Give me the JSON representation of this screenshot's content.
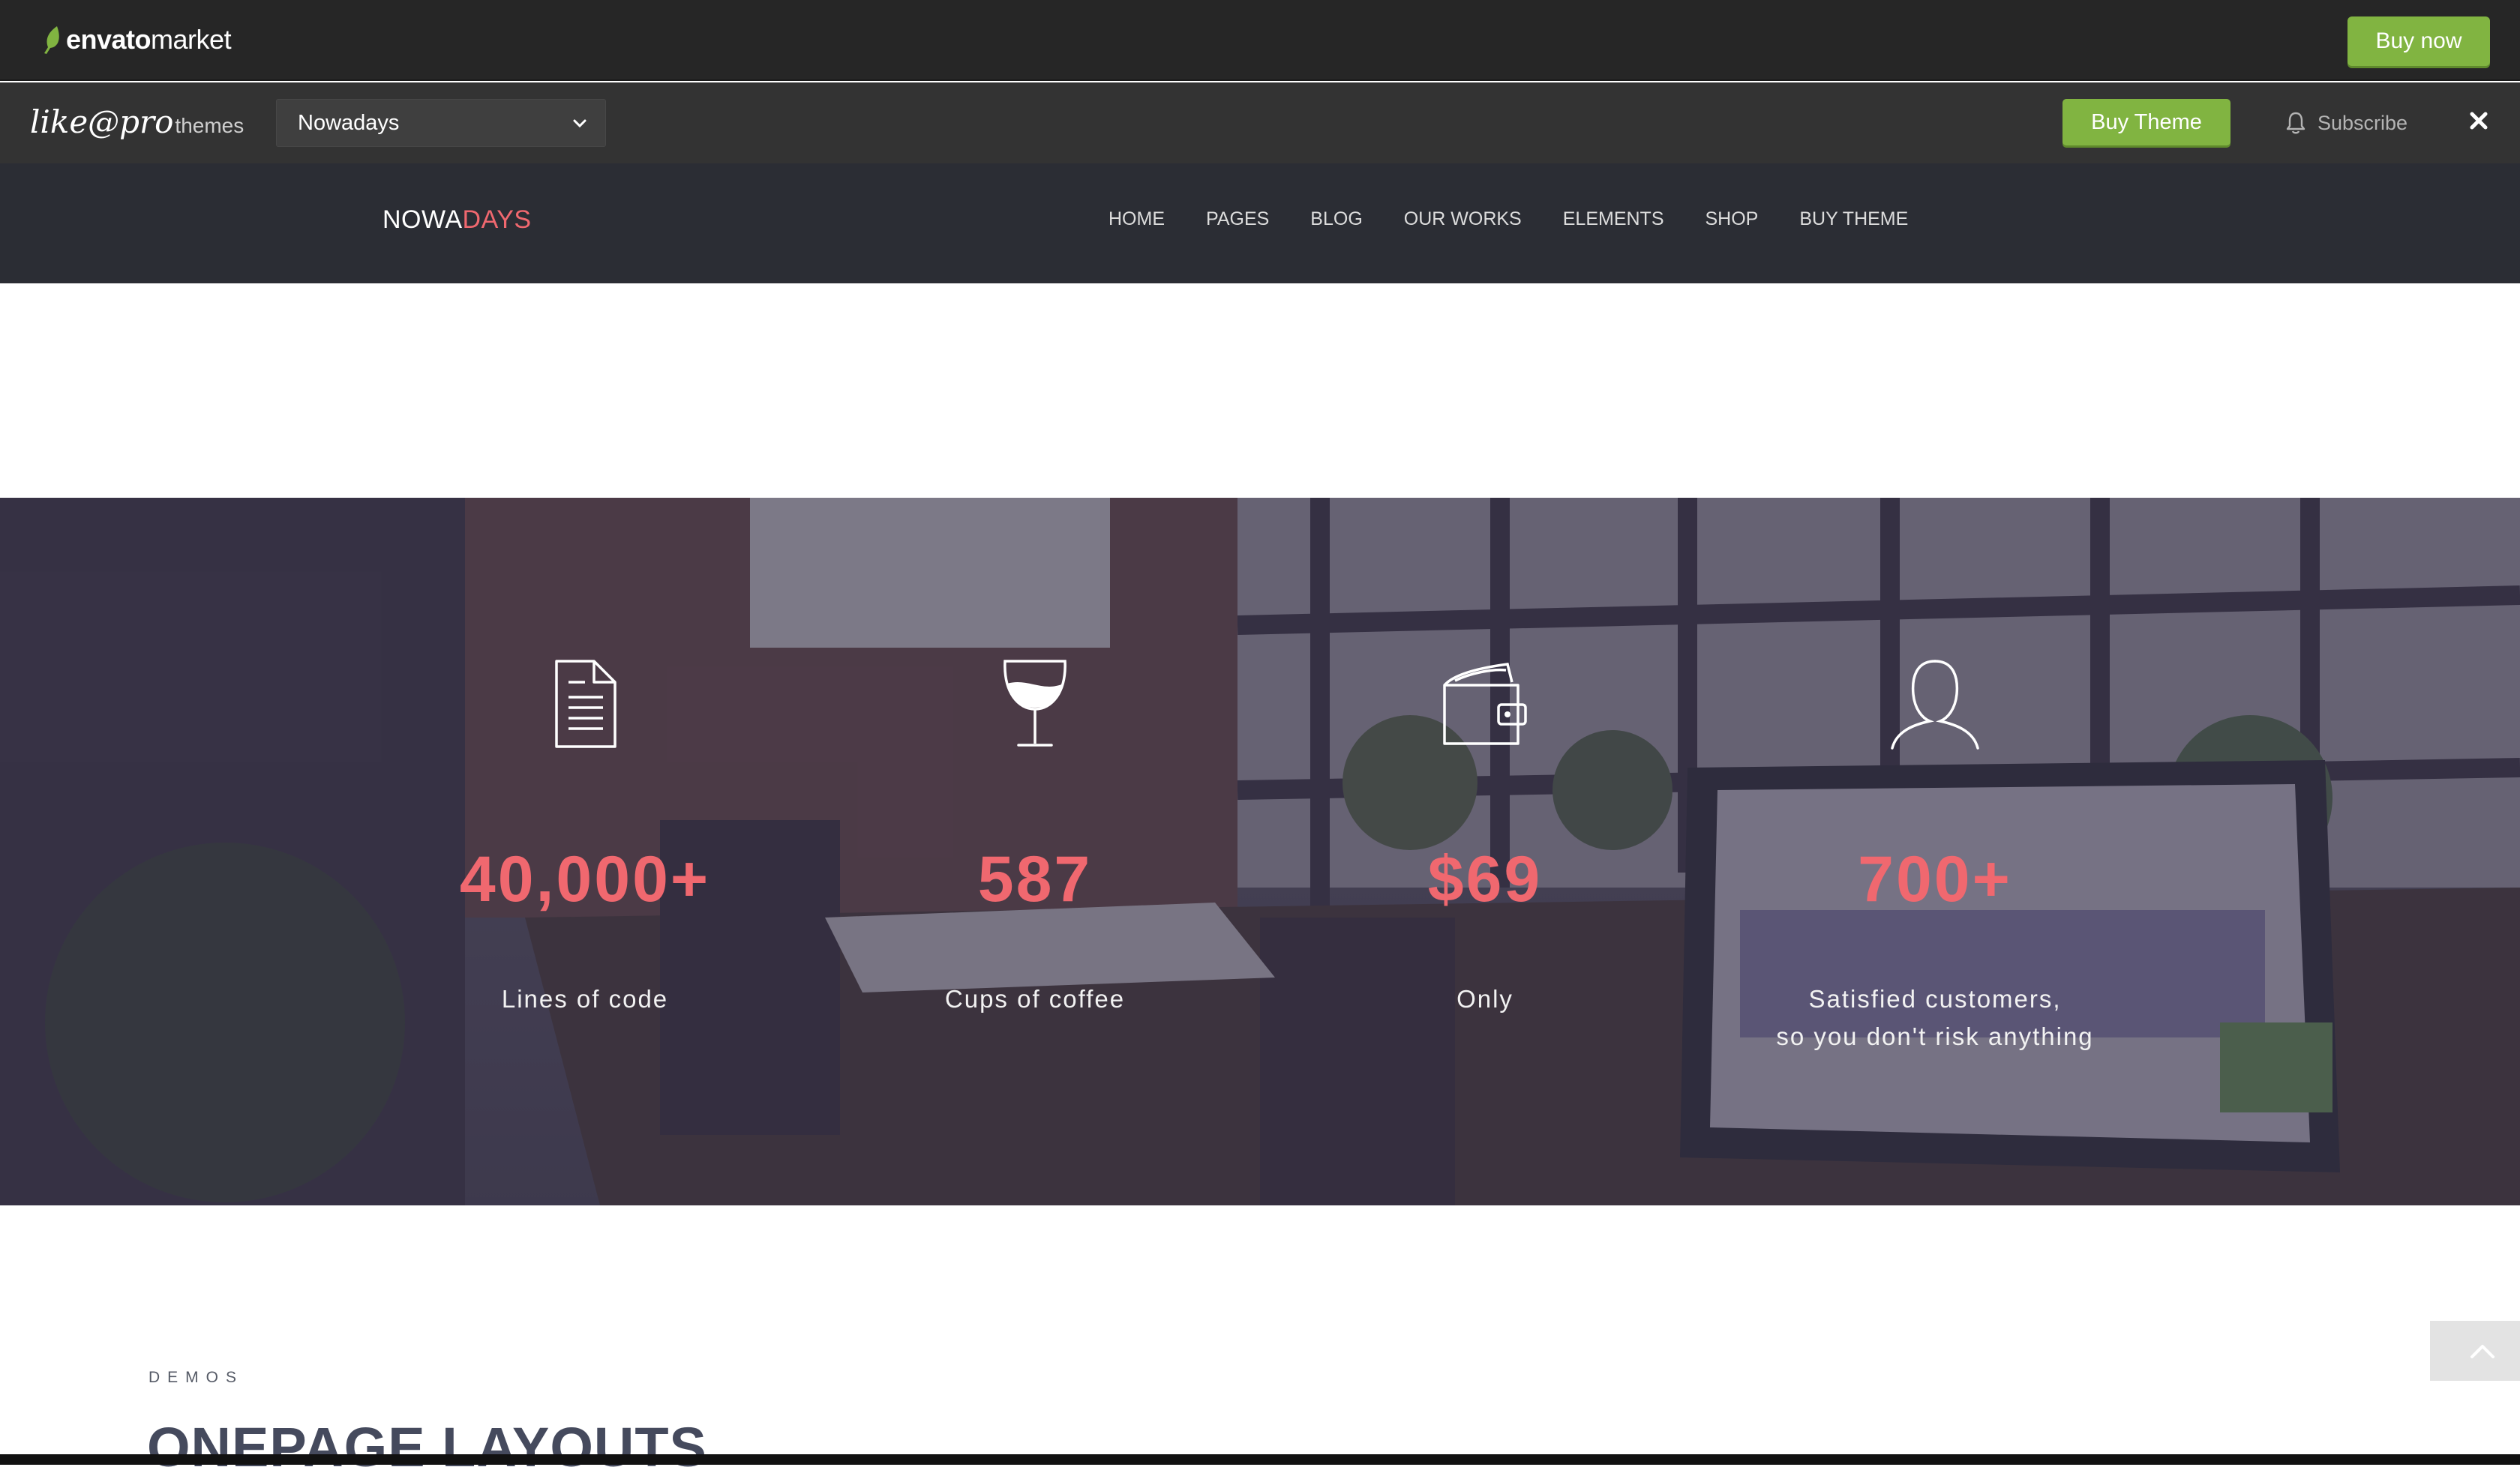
{
  "envato": {
    "logo_brand": "envato",
    "logo_sub": "market",
    "buy_now": "Buy now"
  },
  "demo_bar": {
    "logo_script": "like@pro",
    "logo_themes": "themes",
    "selected_theme": "Nowadays",
    "buy_theme": "Buy Theme",
    "subscribe": "Subscribe"
  },
  "site": {
    "logo_part1": "NOWA",
    "logo_part2": "DAYS",
    "nav": [
      "HOME",
      "PAGES",
      "BLOG",
      "OUR WORKS",
      "ELEMENTS",
      "SHOP",
      "BUY THEME"
    ]
  },
  "stats": [
    {
      "icon": "document-icon",
      "value": "40,000+",
      "label_line1": "Lines of code",
      "label_line2": ""
    },
    {
      "icon": "wine-glass-icon",
      "value": "587",
      "label_line1": "Cups of coffee",
      "label_line2": ""
    },
    {
      "icon": "wallet-icon",
      "value": "$69",
      "label_line1": "Only",
      "label_line2": ""
    },
    {
      "icon": "person-icon",
      "value": "700+",
      "label_line1": "Satisfied customers,",
      "label_line2": "so you don't risk anything"
    }
  ],
  "demos": {
    "label": "DEMOS",
    "title": "ONEPAGE LAYOUTS"
  },
  "colors": {
    "accent": "#f0686f",
    "green": "#81b441",
    "nav_bg": "#2b2d34"
  }
}
